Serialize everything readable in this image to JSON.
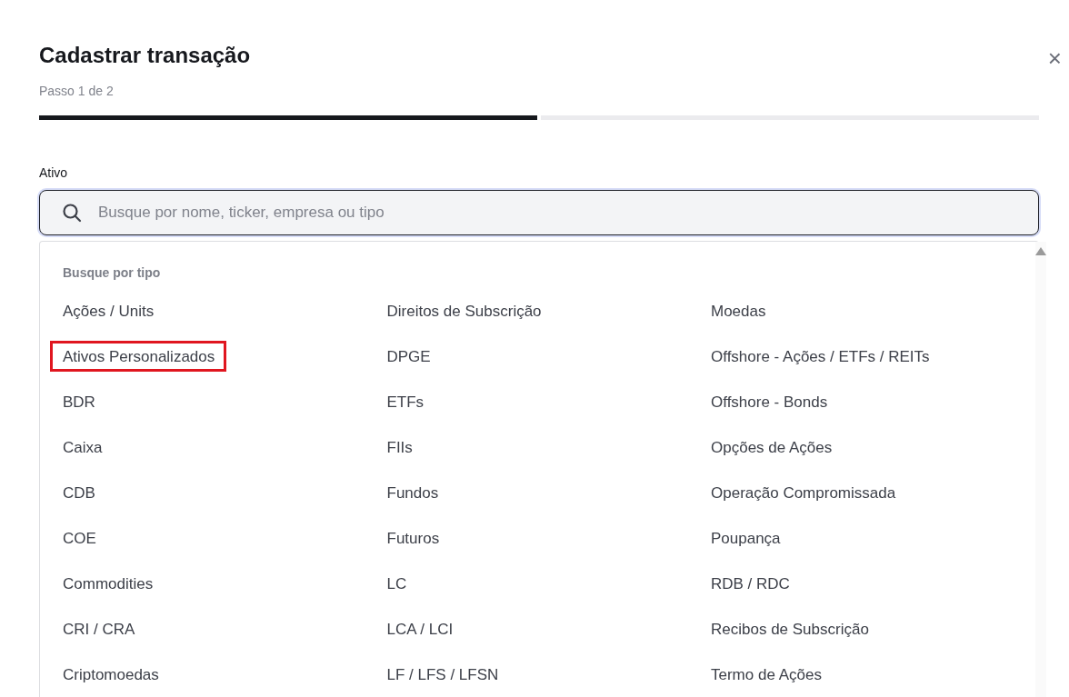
{
  "dialog": {
    "title": "Cadastrar transação",
    "close_icon": "×",
    "step_text": "Passo 1 de 2",
    "steps": [
      {
        "done": true
      },
      {
        "done": false
      }
    ],
    "field": {
      "label": "Ativo",
      "placeholder": "Busque por nome, ticker, empresa ou tipo"
    },
    "dropdown": {
      "heading": "Busque por tipo",
      "columns": [
        [
          {
            "label": "Ações / Units",
            "highlighted": false
          },
          {
            "label": "Ativos Personalizados",
            "highlighted": true
          },
          {
            "label": "BDR",
            "highlighted": false
          },
          {
            "label": "Caixa",
            "highlighted": false
          },
          {
            "label": "CDB",
            "highlighted": false
          },
          {
            "label": "COE",
            "highlighted": false
          },
          {
            "label": "Commodities",
            "highlighted": false
          },
          {
            "label": "CRI / CRA",
            "highlighted": false
          },
          {
            "label": "Criptomoedas",
            "highlighted": false
          }
        ],
        [
          {
            "label": "Direitos de Subscrição",
            "highlighted": false
          },
          {
            "label": "DPGE",
            "highlighted": false
          },
          {
            "label": "ETFs",
            "highlighted": false
          },
          {
            "label": "FIIs",
            "highlighted": false
          },
          {
            "label": "Fundos",
            "highlighted": false
          },
          {
            "label": "Futuros",
            "highlighted": false
          },
          {
            "label": "LC",
            "highlighted": false
          },
          {
            "label": "LCA / LCI",
            "highlighted": false
          },
          {
            "label": "LF / LFS / LFSN",
            "highlighted": false
          }
        ],
        [
          {
            "label": "Moedas",
            "highlighted": false
          },
          {
            "label": "Offshore - Ações / ETFs / REITs",
            "highlighted": false
          },
          {
            "label": "Offshore - Bonds",
            "highlighted": false
          },
          {
            "label": "Opções de Ações",
            "highlighted": false
          },
          {
            "label": "Operação Compromissada",
            "highlighted": false
          },
          {
            "label": "Poupança",
            "highlighted": false
          },
          {
            "label": "RDB / RDC",
            "highlighted": false
          },
          {
            "label": "Recibos de Subscrição",
            "highlighted": false
          },
          {
            "label": "Termo de Ações",
            "highlighted": false
          }
        ]
      ]
    }
  }
}
